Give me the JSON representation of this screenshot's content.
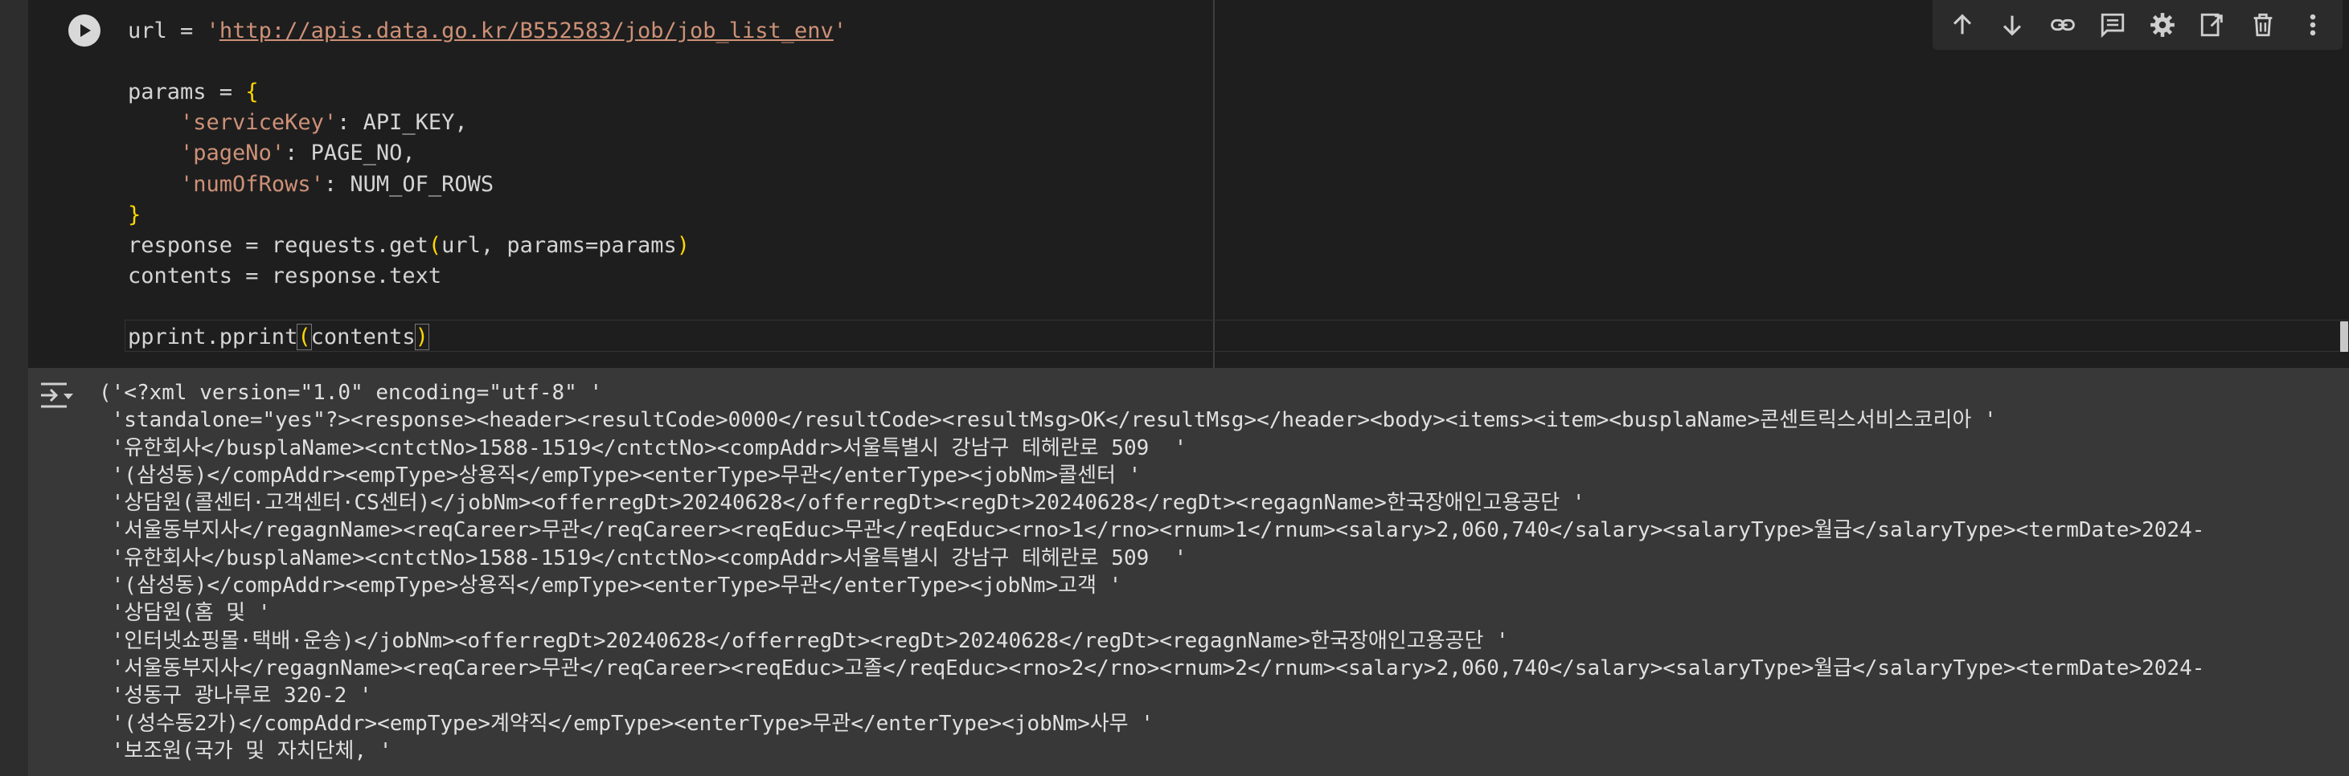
{
  "code": {
    "lines": [
      {
        "id": "url",
        "parts": [
          [
            "url = ",
            ""
          ],
          [
            "'",
            ""
          ],
          [
            "http://apis.data.go.kr/B552583/job/job_list_env",
            "url"
          ],
          [
            "'",
            "str"
          ]
        ]
      },
      {
        "id": "blank1",
        "parts": []
      },
      {
        "id": "params",
        "parts": [
          [
            "params = ",
            ""
          ],
          [
            "{",
            "brk"
          ]
        ]
      },
      {
        "id": "servicekey",
        "parts": [
          [
            "    ",
            ""
          ],
          [
            "'serviceKey'",
            "str"
          ],
          [
            ": API_KEY,",
            ""
          ]
        ]
      },
      {
        "id": "pageno",
        "parts": [
          [
            "    ",
            ""
          ],
          [
            "'pageNo'",
            "str"
          ],
          [
            ": PAGE_NO,",
            ""
          ]
        ]
      },
      {
        "id": "numofrows",
        "parts": [
          [
            "    ",
            ""
          ],
          [
            "'numOfRows'",
            "str"
          ],
          [
            ": NUM_OF_ROWS",
            ""
          ]
        ]
      },
      {
        "id": "close-brace",
        "parts": [
          [
            "}",
            "brk"
          ]
        ]
      },
      {
        "id": "response",
        "parts": [
          [
            "response = requests.get",
            ""
          ],
          [
            "(",
            "brk"
          ],
          [
            "url, params=params",
            ""
          ],
          [
            ")",
            "brk"
          ]
        ]
      },
      {
        "id": "contents",
        "parts": [
          [
            "contents = response.text",
            ""
          ]
        ]
      },
      {
        "id": "blank2",
        "parts": []
      },
      {
        "id": "pprint",
        "parts": [
          [
            "pprint.pprint",
            ""
          ],
          [
            "(",
            "cur brk"
          ],
          [
            "contents",
            ""
          ],
          [
            ")",
            "cur brk"
          ]
        ]
      }
    ]
  },
  "toolbar": {
    "items": [
      {
        "name": "move-up-icon"
      },
      {
        "name": "move-down-icon"
      },
      {
        "name": "link-icon"
      },
      {
        "name": "comment-icon"
      },
      {
        "name": "gear-icon"
      },
      {
        "name": "mirror-cell-icon"
      },
      {
        "name": "trash-icon"
      },
      {
        "name": "more-vert-icon"
      }
    ]
  },
  "output": {
    "lines": [
      "('<?xml version=\"1.0\" encoding=\"utf-8\" '",
      " 'standalone=\"yes\"?><response><header><resultCode>0000</resultCode><resultMsg>OK</resultMsg></header><body><items><item><busplaName>콘센트릭스서비스코리아 '",
      " '유한회사</busplaName><cntctNo>1588-1519</cntctNo><compAddr>서울특별시 강남구 테헤란로 509  '",
      " '(삼성동)</compAddr><empType>상용직</empType><enterType>무관</enterType><jobNm>콜센터 '",
      " '상담원(콜센터·고객센터·CS센터)</jobNm><offerregDt>20240628</offerregDt><regDt>20240628</regDt><regagnName>한국장애인고용공단 '",
      " '서울동부지사</regagnName><reqCareer>무관</reqCareer><reqEduc>무관</reqEduc><rno>1</rno><rnum>1</rnum><salary>2,060,740</salary><salaryType>월급</salaryType><termDate>2024-",
      " '유한회사</busplaName><cntctNo>1588-1519</cntctNo><compAddr>서울특별시 강남구 테헤란로 509  '",
      " '(삼성동)</compAddr><empType>상용직</empType><enterType>무관</enterType><jobNm>고객 '",
      " '상담원(홈 및 '",
      " '인터넷쇼핑몰·택배·운송)</jobNm><offerregDt>20240628</offerregDt><regDt>20240628</regDt><regagnName>한국장애인고용공단 '",
      " '서울동부지사</regagnName><reqCareer>무관</reqCareer><reqEduc>고졸</reqEduc><rno>2</rno><rnum>2</rnum><salary>2,060,740</salary><salaryType>월급</salaryType><termDate>2024-",
      " '성동구 광나루로 320-2 '",
      " '(성수동2가)</compAddr><empType>계약직</empType><enterType>무관</enterType><jobNm>사무 '",
      " '보조원(국가 및 자치단체, '"
    ]
  }
}
